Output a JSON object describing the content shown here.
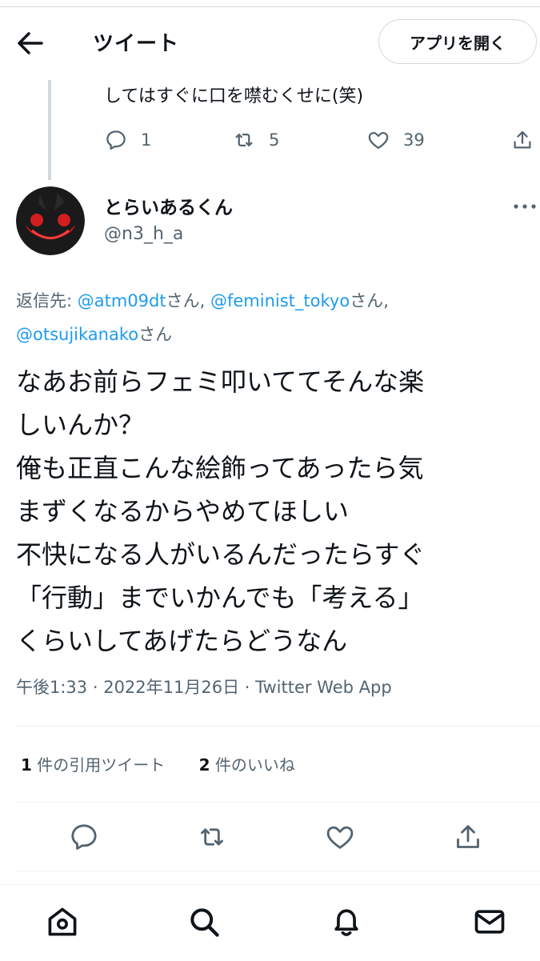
{
  "header": {
    "title": "ツイート",
    "open_app_label": "アプリを開く"
  },
  "previous_tweet": {
    "text_tail": "してはすぐに口を噤むくせに(笑)",
    "replies": "1",
    "retweets": "5",
    "likes": "39"
  },
  "tweet": {
    "display_name": "とらいあるくん",
    "handle": "@n3_h_a",
    "reply_prefix": "返信先: ",
    "mentions": [
      "@atm09dt",
      "@feminist_tokyo",
      "@otsujikanako"
    ],
    "san": "さん",
    "sep": ", ",
    "lines": [
      "なあお前らフェミ叩いててそんな楽",
      "しいんか？",
      "俺も正直こんな絵飾ってあったら気",
      "まずくなるからやめてほしい",
      "不快になる人がいるんだったらすぐ",
      "「行動」までいかんでも「考える」",
      "くらいしてあげたらどうなん"
    ],
    "time": "午後1:33",
    "date": "2022年11月26日",
    "dot": " · ",
    "source": "Twitter Web App",
    "quote_count": "1",
    "quote_label": " 件の引用ツイート",
    "like_count": "2",
    "like_label": " 件のいいね"
  },
  "colors": {
    "accent": "#1d9bf0",
    "secondary_text": "#536471",
    "primary_text": "#0f1419",
    "border": "#eff3f4"
  },
  "icons": [
    "back-arrow-icon",
    "reply-icon",
    "retweet-icon",
    "like-icon",
    "share-icon",
    "more-icon",
    "home-icon",
    "search-icon",
    "notifications-icon",
    "messages-icon"
  ]
}
